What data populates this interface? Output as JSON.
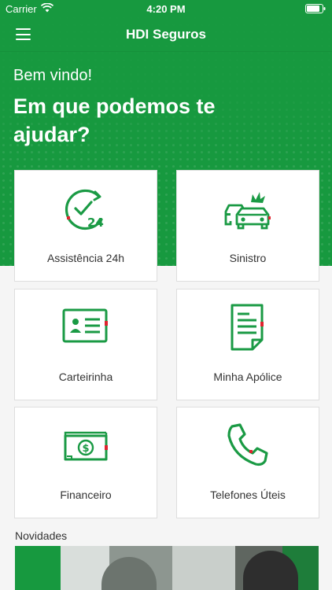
{
  "status_bar": {
    "carrier": "Carrier",
    "time": "4:20 PM"
  },
  "nav": {
    "title": "HDI Seguros"
  },
  "hero": {
    "welcome": "Bem vindo!",
    "headline": "Em que podemos te ajudar?"
  },
  "cards": [
    {
      "label": "Assistência 24h",
      "icon": "clock-24-icon"
    },
    {
      "label": "Sinistro",
      "icon": "car-crash-icon"
    },
    {
      "label": "Carteirinha",
      "icon": "id-card-icon"
    },
    {
      "label": "Minha Apólice",
      "icon": "document-icon"
    },
    {
      "label": "Financeiro",
      "icon": "money-bill-icon"
    },
    {
      "label": "Telefones Úteis",
      "icon": "phone-icon"
    }
  ],
  "news": {
    "title": "Novidades"
  },
  "colors": {
    "brand_green": "#17993f",
    "icon_green": "#1a9a44",
    "accent_red": "#e0232e",
    "background": "#f5f5f5"
  }
}
